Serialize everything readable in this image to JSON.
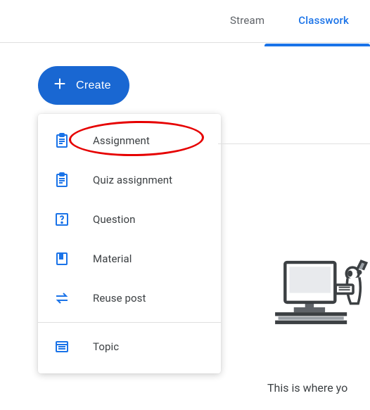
{
  "tabs": {
    "stream": "Stream",
    "classwork": "Classwork"
  },
  "create": {
    "label": "Create"
  },
  "menu": {
    "assignment": "Assignment",
    "quiz_assignment": "Quiz assignment",
    "question": "Question",
    "material": "Material",
    "reuse_post": "Reuse post",
    "topic": "Topic"
  },
  "hint_text": "This is where yo"
}
